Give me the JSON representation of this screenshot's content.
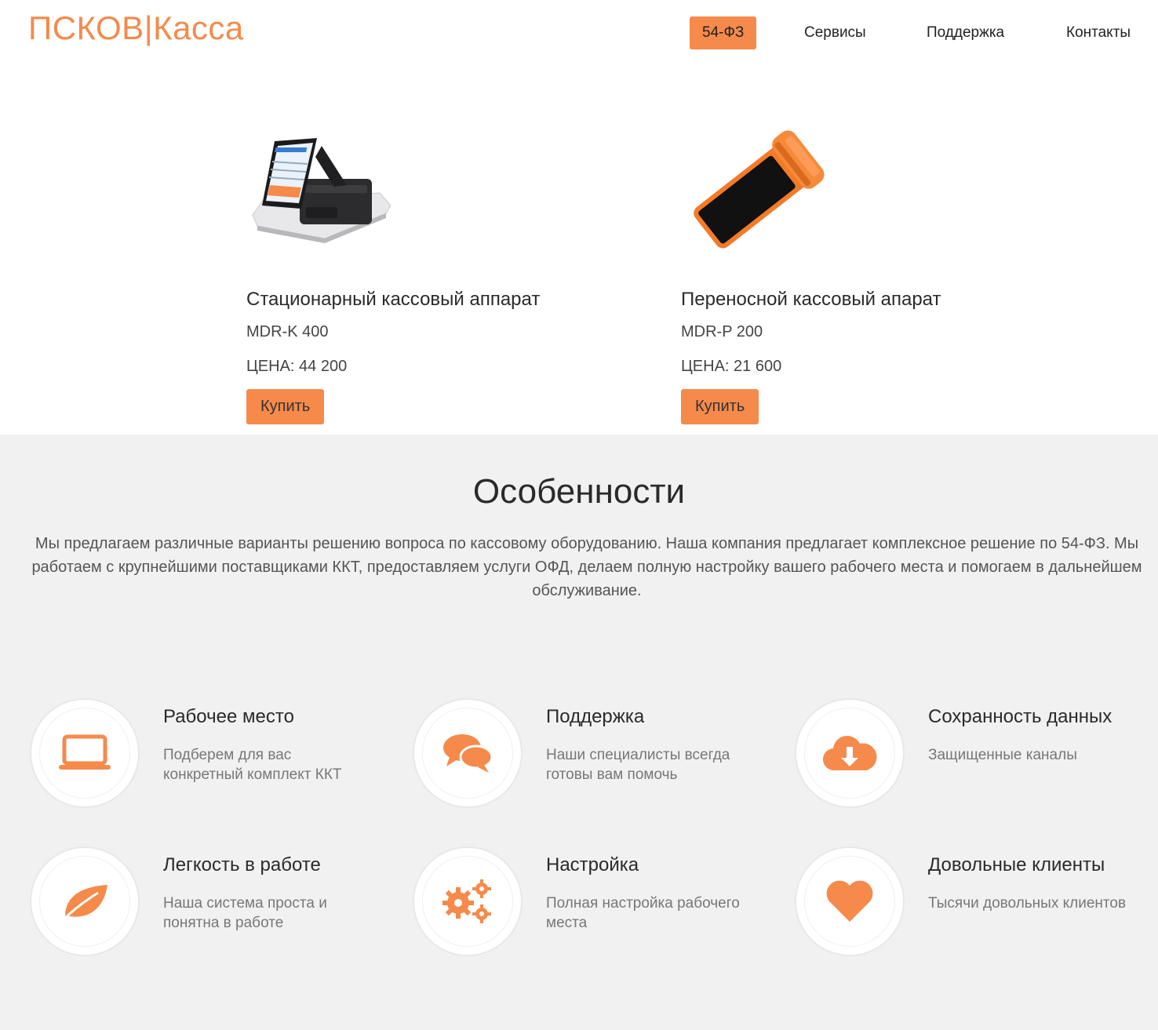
{
  "header": {
    "logo": "ПСКОВ|Касса",
    "nav": [
      {
        "label": "54-ФЗ",
        "active": true
      },
      {
        "label": "Сервисы",
        "active": false
      },
      {
        "label": "Поддержка",
        "active": false
      },
      {
        "label": "Контакты",
        "active": false
      }
    ]
  },
  "products": [
    {
      "title": "Стационарный кассовый аппарат",
      "model": "MDR-K 400",
      "price": "ЦЕНА: 44 200",
      "buy_label": "Купить",
      "image_icon": "stationary-register-image"
    },
    {
      "title": "Переносной кассовый апарат",
      "model": "MDR-P 200",
      "price": "ЦЕНА: 21 600",
      "buy_label": "Купить",
      "image_icon": "portable-register-image"
    }
  ],
  "features": {
    "title": "Особенности",
    "description": "Мы предлагаем различные варианты решению вопроса по кассовому оборудованию. Наша компания предлагает комплексное решение по 54-ФЗ. Мы работаем с крупнейшими поставщиками ККТ, предоставляем услуги ОФД, делаем полную настройку вашего рабочего места и помогаем в дальнейшем обслуживание.",
    "items": [
      {
        "title": "Рабочее место",
        "text": "Подберем для вас конкретный комплект ККТ",
        "icon": "laptop-icon"
      },
      {
        "title": "Поддержка",
        "text": "Наши специалисты всегда готовы вам помочь",
        "icon": "chat-bubbles-icon"
      },
      {
        "title": "Сохранность данных",
        "text": "Защищенные каналы",
        "icon": "cloud-download-icon"
      },
      {
        "title": "Легкость в работе",
        "text": "Наша система проста и понятна в работе",
        "icon": "leaf-icon"
      },
      {
        "title": "Настройка",
        "text": "Полная настройка рабочего места",
        "icon": "gears-icon"
      },
      {
        "title": "Довольные клиенты",
        "text": "Тысячи довольных клиентов",
        "icon": "heart-icon"
      }
    ]
  },
  "colors": {
    "accent": "#f58a4b",
    "features_bg": "#f1f1f1"
  }
}
